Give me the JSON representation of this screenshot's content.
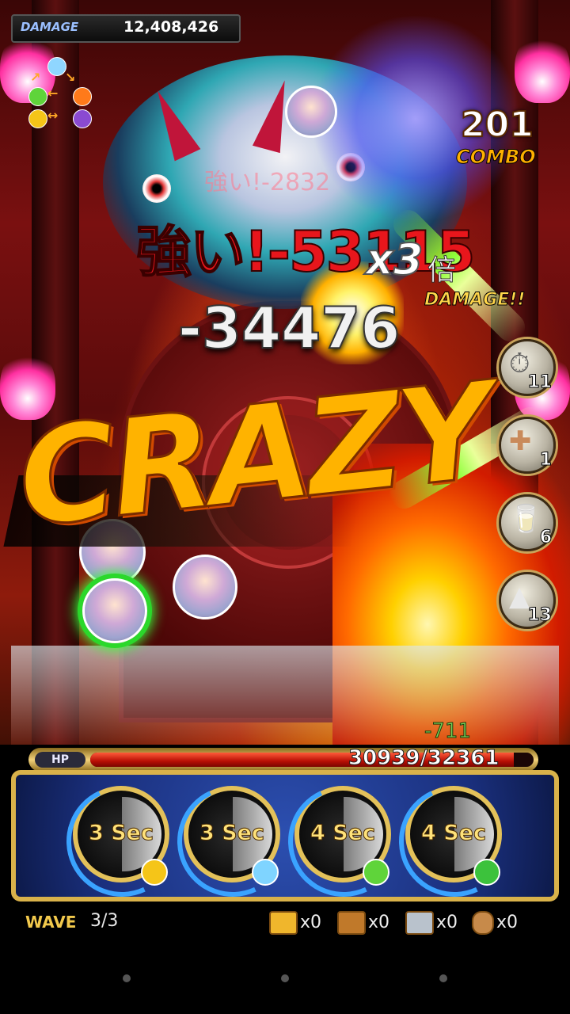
{
  "damage_bar": {
    "label": "DAMAGE",
    "value": "12,408,426"
  },
  "combo": {
    "count": "201",
    "label": "COMBO"
  },
  "floating_text": {
    "jp_damage": "強い!-53115",
    "jp_damage_ghost": "強い!-2832",
    "multiplier": "x3",
    "multiplier_kanji": "倍",
    "multiplier_label": "DAMAGE!!",
    "hit_value": "-34476",
    "crazy": "CRAZY",
    "heal_value": "-711"
  },
  "items": [
    {
      "icon": "stopwatch-icon",
      "glyph": "⏱",
      "count": "11"
    },
    {
      "icon": "bandage-icon",
      "glyph": "✚",
      "count": "1"
    },
    {
      "icon": "milk-bottle-icon",
      "glyph": "🥛",
      "count": "6"
    },
    {
      "icon": "onigiri-icon",
      "glyph": "▲",
      "count": "13"
    }
  ],
  "hp": {
    "label": "HP",
    "current": 30939,
    "max": 32361,
    "text": "30939/32361"
  },
  "skills": [
    {
      "label": "3 Sec",
      "gem_color": "#f5c518"
    },
    {
      "label": "3 Sec",
      "gem_color": "#7fd4ff"
    },
    {
      "label": "4 Sec",
      "gem_color": "#5fd43a"
    },
    {
      "label": "4 Sec",
      "gem_color": "#3cc23c"
    }
  ],
  "footer": {
    "wave_label": "WAVE",
    "wave_value": "3/3",
    "loot": [
      {
        "icon": "gold-chest-icon",
        "count": "x0",
        "color": "#f0b62c"
      },
      {
        "icon": "bronze-chest-icon",
        "count": "x0",
        "color": "#c0792a"
      },
      {
        "icon": "silver-chest-icon",
        "count": "x0",
        "color": "#b9c2cc"
      },
      {
        "icon": "money-bag-icon",
        "count": "x0",
        "color": "#c78a4a"
      }
    ]
  },
  "colors": {
    "accent_gold": "#e3c15a",
    "hp_red": "#b80f05",
    "crazy_orange": "#ffb300"
  }
}
